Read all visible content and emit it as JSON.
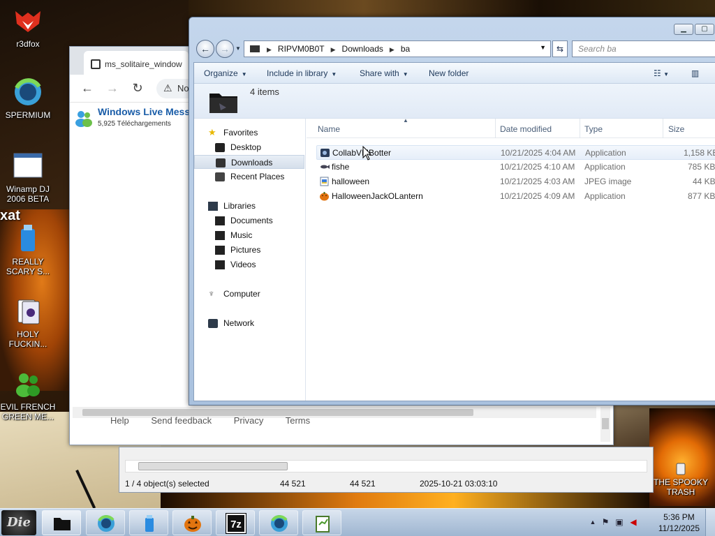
{
  "desktop": {
    "icons": [
      {
        "label": "r3dfox"
      },
      {
        "label": "SPERMIUM"
      },
      {
        "label": "Winamp DJ 2006 BETA"
      },
      {
        "label": "REALLY SCARY S..."
      },
      {
        "label": "HOLY FUCKIN..."
      },
      {
        "label": "EVIL FRENCH GREEN ME..."
      },
      {
        "label": "THE SPOOKY TRASH"
      }
    ],
    "wallpaper_text": "xat"
  },
  "browser": {
    "tab_title": "ms_solitaire_window",
    "address_text": "Not",
    "content_title": "Windows Live Messenger",
    "content_subtitle": "5,925 Téléchargements",
    "footer_links": [
      "Help",
      "Send feedback",
      "Privacy",
      "Terms"
    ]
  },
  "zip_window": {
    "status": {
      "selected": "1 / 4 object(s) selected",
      "size": "44 521",
      "packed": "44 521",
      "modified": "2025-10-21 03:03:10"
    }
  },
  "explorer": {
    "breadcrumb": [
      "RIPVM0B0T",
      "Downloads",
      "ba"
    ],
    "search_placeholder": "Search ba",
    "commands": {
      "organize": "Organize",
      "include": "Include in library",
      "share": "Share with",
      "new_folder": "New folder"
    },
    "item_count": "4 items",
    "nav": {
      "favorites": "Favorites",
      "desktop": "Desktop",
      "downloads": "Downloads",
      "recent": "Recent Places",
      "libraries": "Libraries",
      "documents": "Documents",
      "music": "Music",
      "pictures": "Pictures",
      "videos": "Videos",
      "computer": "Computer",
      "network": "Network"
    },
    "columns": {
      "name": "Name",
      "date": "Date modified",
      "type": "Type",
      "size": "Size"
    },
    "files": [
      {
        "name": "CollabVMBotter",
        "date": "10/21/2025 4:04 AM",
        "type": "Application",
        "size": "1,158 KB"
      },
      {
        "name": "fishe",
        "date": "10/21/2025 4:10 AM",
        "type": "Application",
        "size": "785 KB"
      },
      {
        "name": "halloween",
        "date": "10/21/2025 4:03 AM",
        "type": "JPEG image",
        "size": "44 KB"
      },
      {
        "name": "HalloweenJackOLantern",
        "date": "10/21/2025 4:09 AM",
        "type": "Application",
        "size": "877 KB"
      }
    ]
  },
  "taskbar": {
    "start_label": "Die",
    "time": "5:36 PM",
    "date": "11/12/2025",
    "seven_zip_label": "7z"
  }
}
